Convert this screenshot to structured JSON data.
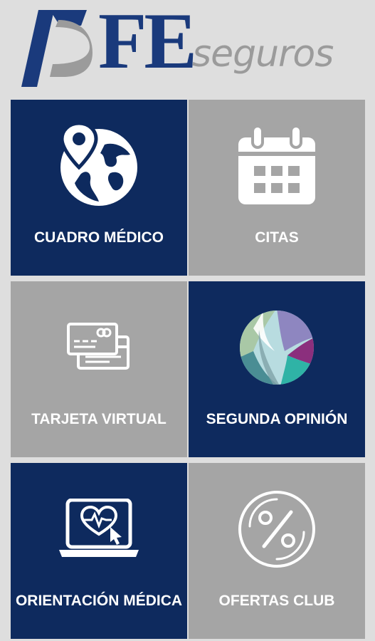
{
  "brand": {
    "wordmark": "FE",
    "tagline": "seguros",
    "primary_color": "#0e2a5e",
    "secondary_color": "#a5a5a5"
  },
  "tiles": [
    {
      "label": "CUADRO MÉDICO",
      "icon": "globe-location-icon",
      "color": "navy"
    },
    {
      "label": "CITAS",
      "icon": "calendar-icon",
      "color": "gray"
    },
    {
      "label": "TARJETA VIRTUAL",
      "icon": "credit-card-icon",
      "color": "gray"
    },
    {
      "label": "SEGUNDA OPINIÓN",
      "icon": "color-sphere-icon",
      "color": "navy"
    },
    {
      "label": "ORIENTACIÓN MÉDICA",
      "icon": "laptop-heart-icon",
      "color": "navy"
    },
    {
      "label": "OFERTAS CLUB",
      "icon": "percent-badge-icon",
      "color": "gray"
    }
  ]
}
